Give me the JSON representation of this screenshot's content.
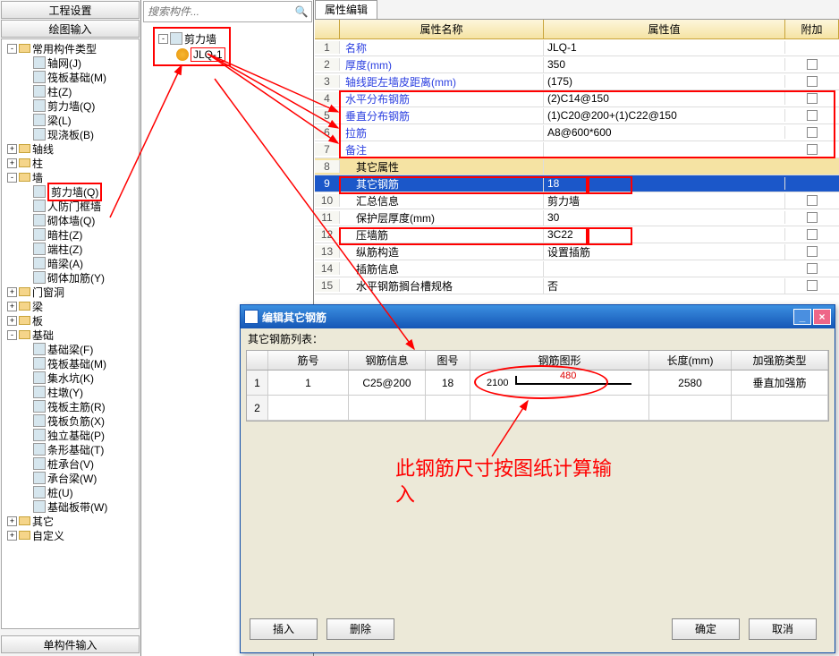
{
  "left": {
    "bar1": "工程设置",
    "bar2": "绘图输入",
    "bar3": "单构件输入",
    "tree": [
      {
        "ind": 0,
        "tog": "-",
        "ic": "fold",
        "label": "常用构件类型",
        "cls": ""
      },
      {
        "ind": 1,
        "tog": "",
        "ic": "small",
        "label": "轴网(J)",
        "cls": ""
      },
      {
        "ind": 1,
        "tog": "",
        "ic": "small",
        "label": "筏板基础(M)",
        "cls": ""
      },
      {
        "ind": 1,
        "tog": "",
        "ic": "small",
        "label": "柱(Z)",
        "cls": ""
      },
      {
        "ind": 1,
        "tog": "",
        "ic": "small",
        "label": "剪力墙(Q)",
        "cls": ""
      },
      {
        "ind": 1,
        "tog": "",
        "ic": "small",
        "label": "梁(L)",
        "cls": ""
      },
      {
        "ind": 1,
        "tog": "",
        "ic": "small",
        "label": "现浇板(B)",
        "cls": ""
      },
      {
        "ind": 0,
        "tog": "+",
        "ic": "fold",
        "label": "轴线",
        "cls": ""
      },
      {
        "ind": 0,
        "tog": "+",
        "ic": "fold",
        "label": "柱",
        "cls": ""
      },
      {
        "ind": 0,
        "tog": "-",
        "ic": "fold",
        "label": "墙",
        "cls": ""
      },
      {
        "ind": 1,
        "tog": "",
        "ic": "small",
        "label": "剪力墙(Q)",
        "cls": "mark-red"
      },
      {
        "ind": 1,
        "tog": "",
        "ic": "small",
        "label": "人防门框墙",
        "cls": ""
      },
      {
        "ind": 1,
        "tog": "",
        "ic": "small",
        "label": "砌体墙(Q)",
        "cls": ""
      },
      {
        "ind": 1,
        "tog": "",
        "ic": "small",
        "label": "暗柱(Z)",
        "cls": ""
      },
      {
        "ind": 1,
        "tog": "",
        "ic": "small",
        "label": "端柱(Z)",
        "cls": ""
      },
      {
        "ind": 1,
        "tog": "",
        "ic": "small",
        "label": "暗梁(A)",
        "cls": ""
      },
      {
        "ind": 1,
        "tog": "",
        "ic": "small",
        "label": "砌体加筋(Y)",
        "cls": ""
      },
      {
        "ind": 0,
        "tog": "+",
        "ic": "fold",
        "label": "门窗洞",
        "cls": ""
      },
      {
        "ind": 0,
        "tog": "+",
        "ic": "fold",
        "label": "梁",
        "cls": ""
      },
      {
        "ind": 0,
        "tog": "+",
        "ic": "fold",
        "label": "板",
        "cls": ""
      },
      {
        "ind": 0,
        "tog": "-",
        "ic": "fold",
        "label": "基础",
        "cls": ""
      },
      {
        "ind": 1,
        "tog": "",
        "ic": "small",
        "label": "基础梁(F)",
        "cls": ""
      },
      {
        "ind": 1,
        "tog": "",
        "ic": "small",
        "label": "筏板基础(M)",
        "cls": ""
      },
      {
        "ind": 1,
        "tog": "",
        "ic": "small",
        "label": "集水坑(K)",
        "cls": ""
      },
      {
        "ind": 1,
        "tog": "",
        "ic": "small",
        "label": "柱墩(Y)",
        "cls": ""
      },
      {
        "ind": 1,
        "tog": "",
        "ic": "small",
        "label": "筏板主筋(R)",
        "cls": ""
      },
      {
        "ind": 1,
        "tog": "",
        "ic": "small",
        "label": "筏板负筋(X)",
        "cls": ""
      },
      {
        "ind": 1,
        "tog": "",
        "ic": "small",
        "label": "独立基础(P)",
        "cls": ""
      },
      {
        "ind": 1,
        "tog": "",
        "ic": "small",
        "label": "条形基础(T)",
        "cls": ""
      },
      {
        "ind": 1,
        "tog": "",
        "ic": "small",
        "label": "桩承台(V)",
        "cls": ""
      },
      {
        "ind": 1,
        "tog": "",
        "ic": "small",
        "label": "承台梁(W)",
        "cls": ""
      },
      {
        "ind": 1,
        "tog": "",
        "ic": "small",
        "label": "桩(U)",
        "cls": ""
      },
      {
        "ind": 1,
        "tog": "",
        "ic": "small",
        "label": "基础板带(W)",
        "cls": ""
      },
      {
        "ind": 0,
        "tog": "+",
        "ic": "fold",
        "label": "其它",
        "cls": ""
      },
      {
        "ind": 0,
        "tog": "+",
        "ic": "fold",
        "label": "自定义",
        "cls": ""
      }
    ]
  },
  "mid": {
    "search_ph": "搜索构件...",
    "node1": "剪力墙",
    "node2": "JLQ-1"
  },
  "right": {
    "tab": "属性编辑",
    "head_name": "属性名称",
    "head_val": "属性值",
    "head_add": "附加",
    "rows": [
      {
        "n": "1",
        "name": "名称",
        "val": "JLQ-1",
        "chk": false,
        "link": true
      },
      {
        "n": "2",
        "name": "厚度(mm)",
        "val": "350",
        "chk": true,
        "link": true
      },
      {
        "n": "3",
        "name": "轴线距左墙皮距离(mm)",
        "val": "(175)",
        "chk": true,
        "link": true
      },
      {
        "n": "4",
        "name": "水平分布钢筋",
        "val": "(2)C14@150",
        "chk": true,
        "link": true
      },
      {
        "n": "5",
        "name": "垂直分布钢筋",
        "val": "(1)C20@200+(1)C22@150",
        "chk": true,
        "link": true
      },
      {
        "n": "6",
        "name": "拉筋",
        "val": "A8@600*600",
        "chk": true,
        "link": true
      },
      {
        "n": "7",
        "name": "备注",
        "val": "",
        "chk": true,
        "link": true
      },
      {
        "n": "8",
        "name": "其它属性",
        "val": "",
        "chk": false,
        "hdr": true
      },
      {
        "n": "9",
        "name": "其它钢筋",
        "val": "18",
        "chk": false,
        "sel": true
      },
      {
        "n": "10",
        "name": "汇总信息",
        "val": "剪力墙",
        "chk": true
      },
      {
        "n": "11",
        "name": "保护层厚度(mm)",
        "val": "30",
        "chk": true
      },
      {
        "n": "12",
        "name": "压墙筋",
        "val": "3C22",
        "chk": true
      },
      {
        "n": "13",
        "name": "纵筋构造",
        "val": "设置插筋",
        "chk": true
      },
      {
        "n": "14",
        "name": "插筋信息",
        "val": "",
        "chk": true
      },
      {
        "n": "15",
        "name": "水平钢筋搁台槽规格",
        "val": "否",
        "chk": true
      }
    ]
  },
  "dlg": {
    "title": "编辑其它钢筋",
    "note": "其它钢筋列表：",
    "head": {
      "no": "筋号",
      "info": "钢筋信息",
      "fig": "图号",
      "shape": "钢筋图形",
      "len": "长度(mm)",
      "type": "加强筋类型"
    },
    "rows": [
      {
        "n": "1",
        "no": "1",
        "info": "C25@200",
        "fig": "18",
        "v1": "2100",
        "v2": "480",
        "len": "2580",
        "type": "垂直加强筋"
      },
      {
        "n": "2",
        "no": "",
        "info": "",
        "fig": "",
        "v1": "",
        "v2": "",
        "len": "",
        "type": ""
      }
    ],
    "btn_ins": "插入",
    "btn_del": "删除",
    "btn_ok": "确定",
    "btn_cancel": "取消"
  },
  "ann": "此钢筋尺寸按图纸计算输入"
}
